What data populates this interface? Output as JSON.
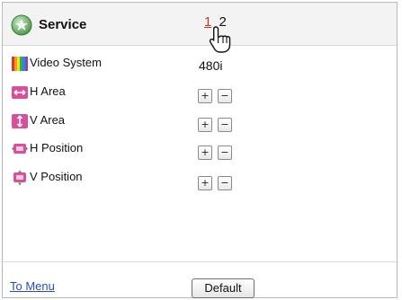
{
  "header": {
    "title": "Service",
    "pages": [
      "1",
      "2"
    ],
    "current_page": "1"
  },
  "rows": [
    {
      "label": "Video System",
      "value": "480i",
      "icon": "rainbow-bars-icon"
    },
    {
      "label": "H Area",
      "icon": "h-area-icon",
      "plus": "+",
      "minus": "−"
    },
    {
      "label": "V Area",
      "icon": "v-area-icon",
      "plus": "+",
      "minus": "−"
    },
    {
      "label": "H Position",
      "icon": "h-position-icon",
      "plus": "+",
      "minus": "−"
    },
    {
      "label": "V Position",
      "icon": "v-position-icon",
      "plus": "+",
      "minus": "−"
    }
  ],
  "footer": {
    "to_menu": "To Menu",
    "default": "Default"
  },
  "colors": {
    "page_active": "#c0392b",
    "link": "#2b4bb5",
    "icon_pink": "#d94f9b"
  }
}
